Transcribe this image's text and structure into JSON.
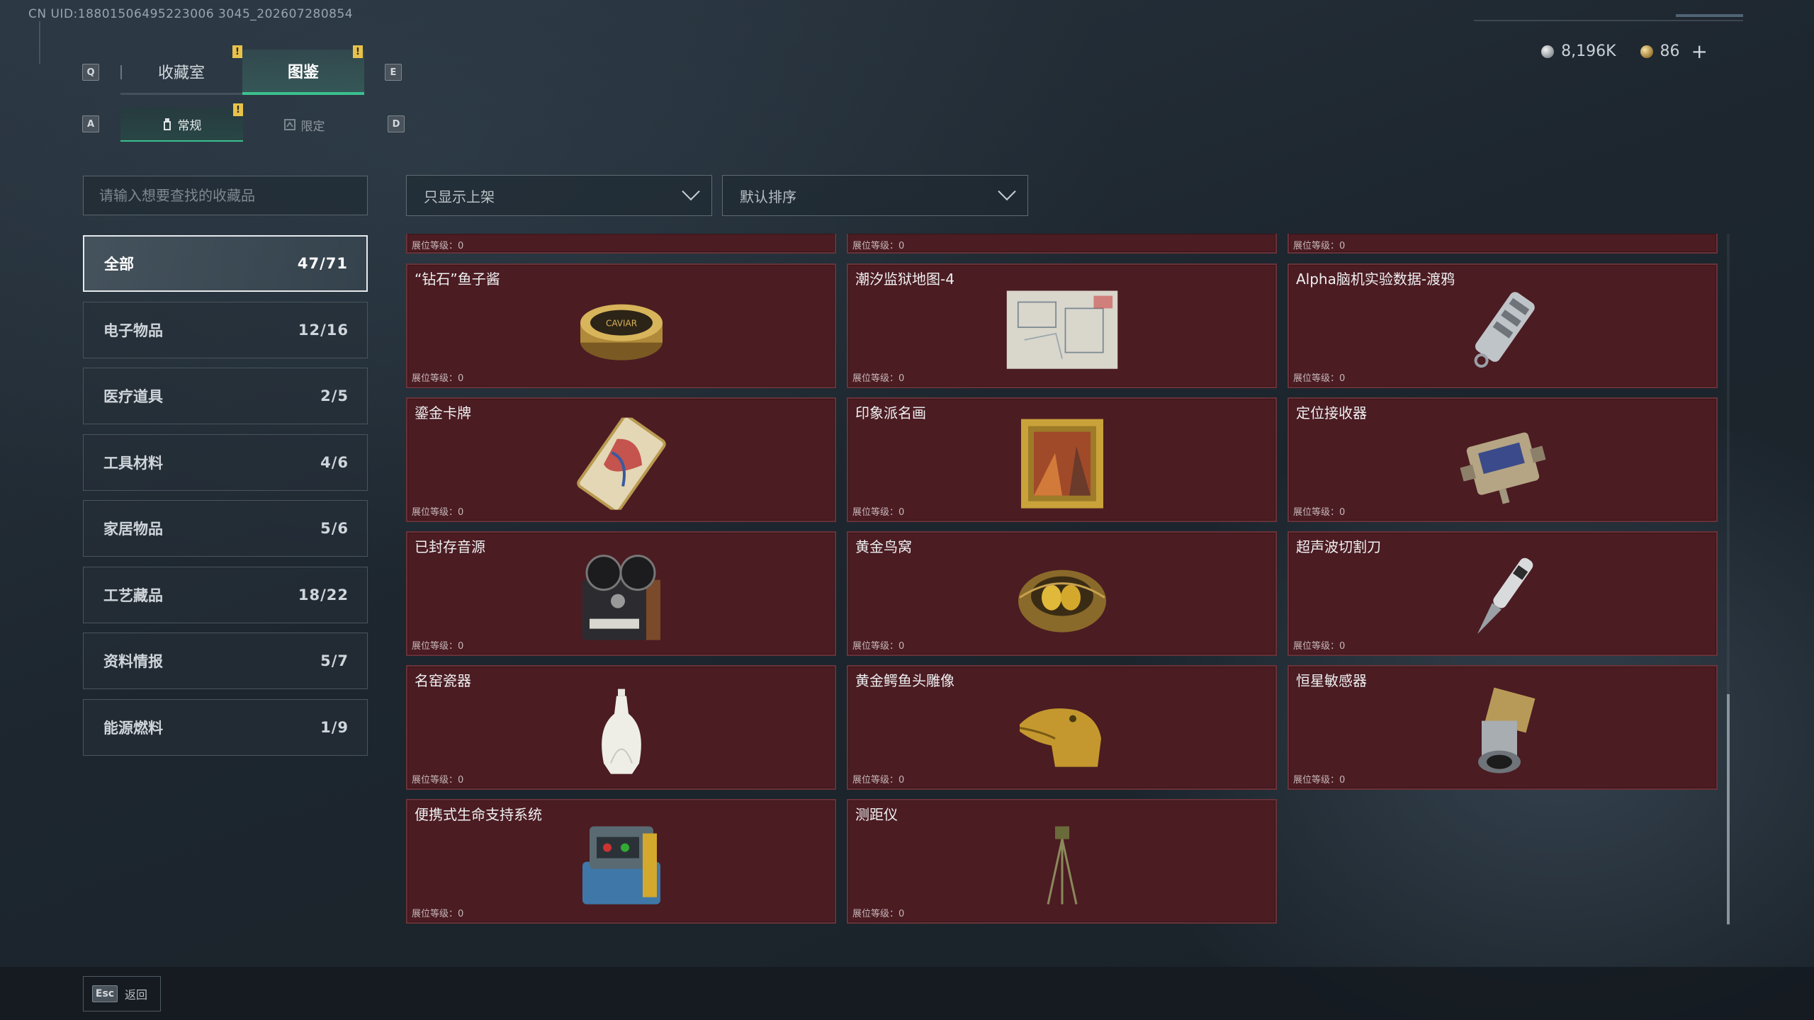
{
  "uid_text": "CN UID:18801506495223006 3045_202607280854",
  "currency": {
    "silver_amount": "8,196K",
    "gold_amount": "86",
    "add_symbol": "+"
  },
  "keys": {
    "q": "Q",
    "e": "E",
    "a": "A",
    "d": "D",
    "esc": "Esc"
  },
  "tabs": [
    {
      "label": "收藏室",
      "active": false,
      "badge": "!"
    },
    {
      "label": "图鉴",
      "active": true,
      "badge": "!"
    }
  ],
  "subtabs": [
    {
      "label": "常规",
      "active": true,
      "badge": "!"
    },
    {
      "label": "限定",
      "active": false
    }
  ],
  "search": {
    "placeholder": "请输入想要查找的收藏品"
  },
  "filters": {
    "shelf_filter": "只显示上架",
    "sort": "默认排序"
  },
  "categories": [
    {
      "label": "全部",
      "count": "47/71",
      "active": true
    },
    {
      "label": "电子物品",
      "count": "12/16"
    },
    {
      "label": "医疗道具",
      "count": "2/5"
    },
    {
      "label": "工具材料",
      "count": "4/6"
    },
    {
      "label": "家居物品",
      "count": "5/6"
    },
    {
      "label": "工艺藏品",
      "count": "18/22"
    },
    {
      "label": "资料情报",
      "count": "5/7"
    },
    {
      "label": "能源燃料",
      "count": "1/9"
    }
  ],
  "level_label": "展位等级：0",
  "items": [
    {
      "name": "“钻石”鱼子酱",
      "icon": "caviar-tin-icon"
    },
    {
      "name": "潮汐监狱地图-4",
      "icon": "prison-map-icon"
    },
    {
      "name": "Alpha脑机实验数据-渡鸦",
      "icon": "data-drive-icon"
    },
    {
      "name": "鎏金卡牌",
      "icon": "gilded-card-icon"
    },
    {
      "name": "印象派名画",
      "icon": "framed-painting-icon"
    },
    {
      "name": "定位接收器",
      "icon": "locator-receiver-icon"
    },
    {
      "name": "已封存音源",
      "icon": "reel-recorder-icon"
    },
    {
      "name": "黄金鸟窝",
      "icon": "golden-nest-icon"
    },
    {
      "name": "超声波切割刀",
      "icon": "ultrasonic-cutter-icon"
    },
    {
      "name": "名窑瓷器",
      "icon": "porcelain-vase-icon"
    },
    {
      "name": "黄金鳄鱼头雕像",
      "icon": "golden-crocodile-icon"
    },
    {
      "name": "恒星敏感器",
      "icon": "star-sensor-icon"
    },
    {
      "name": "便携式生命支持系统",
      "icon": "life-support-icon"
    },
    {
      "name": "测距仪",
      "icon": "rangefinder-icon"
    }
  ],
  "bottom": {
    "back_label": "返回"
  },
  "colors": {
    "accent": "#3bc08e",
    "card_bg": "#4b1c22",
    "card_border": "#6a3238",
    "badge": "#e8c24a"
  }
}
